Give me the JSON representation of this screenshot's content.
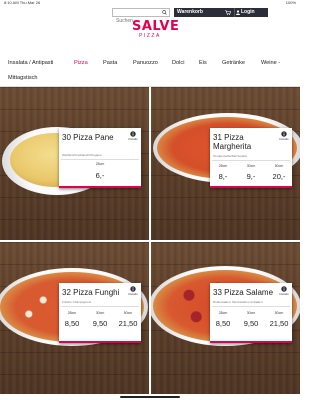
{
  "status_bar": {
    "time": "8:10 AM   Thu Mar 26",
    "battery": "100%"
  },
  "header": {
    "search_placeholder": "Suchen",
    "cart_label": "Warenkorb",
    "login_label": "Login",
    "logo_main": "SALVE",
    "logo_sub": "PIZZA"
  },
  "nav": {
    "items": [
      {
        "label": "Insalata / Antipasti"
      },
      {
        "label": "Pizza"
      },
      {
        "label": "Pasta"
      },
      {
        "label": "Panuozzo"
      },
      {
        "label": "Dolci"
      },
      {
        "label": "Eis"
      },
      {
        "label": "Getränke"
      },
      {
        "label": "Weine -"
      },
      {
        "label": "Mittagstisch"
      }
    ],
    "active": "Pizza"
  },
  "products": [
    {
      "name": "30 Pizza Pane",
      "desc": "Weißbrot/Knoblauch/Oregano",
      "details": "Details",
      "sizes": [
        "28cm"
      ],
      "prices": [
        "6,-"
      ]
    },
    {
      "name": "31 Pizza Margherita",
      "desc": "Tomatensoße/Mozzarella",
      "details": "Details",
      "sizes": [
        "28cm",
        "30cm",
        "50cm"
      ],
      "prices": [
        "8,-",
        "9,-",
        "20,-"
      ]
    },
    {
      "name": "32 Pizza Funghi",
      "desc": "Frische Champignons",
      "details": "Details",
      "sizes": [
        "28cm",
        "30cm",
        "50cm"
      ],
      "prices": [
        "8,50",
        "9,50",
        "21,50"
      ]
    },
    {
      "name": "33 Pizza Salame",
      "desc": "Rindersalami, Mozzarella und Salami",
      "details": "Details",
      "sizes": [
        "28cm",
        "30cm",
        "50cm"
      ],
      "prices": [
        "8,50",
        "9,50",
        "21,50"
      ]
    }
  ],
  "colors": {
    "accent": "#e5004f",
    "dark": "#2d2d3a",
    "wood": "#5b3d27"
  },
  "icons": {
    "search": "search-icon",
    "cart": "cart-icon",
    "login": "user-icon",
    "details": "info-icon"
  }
}
